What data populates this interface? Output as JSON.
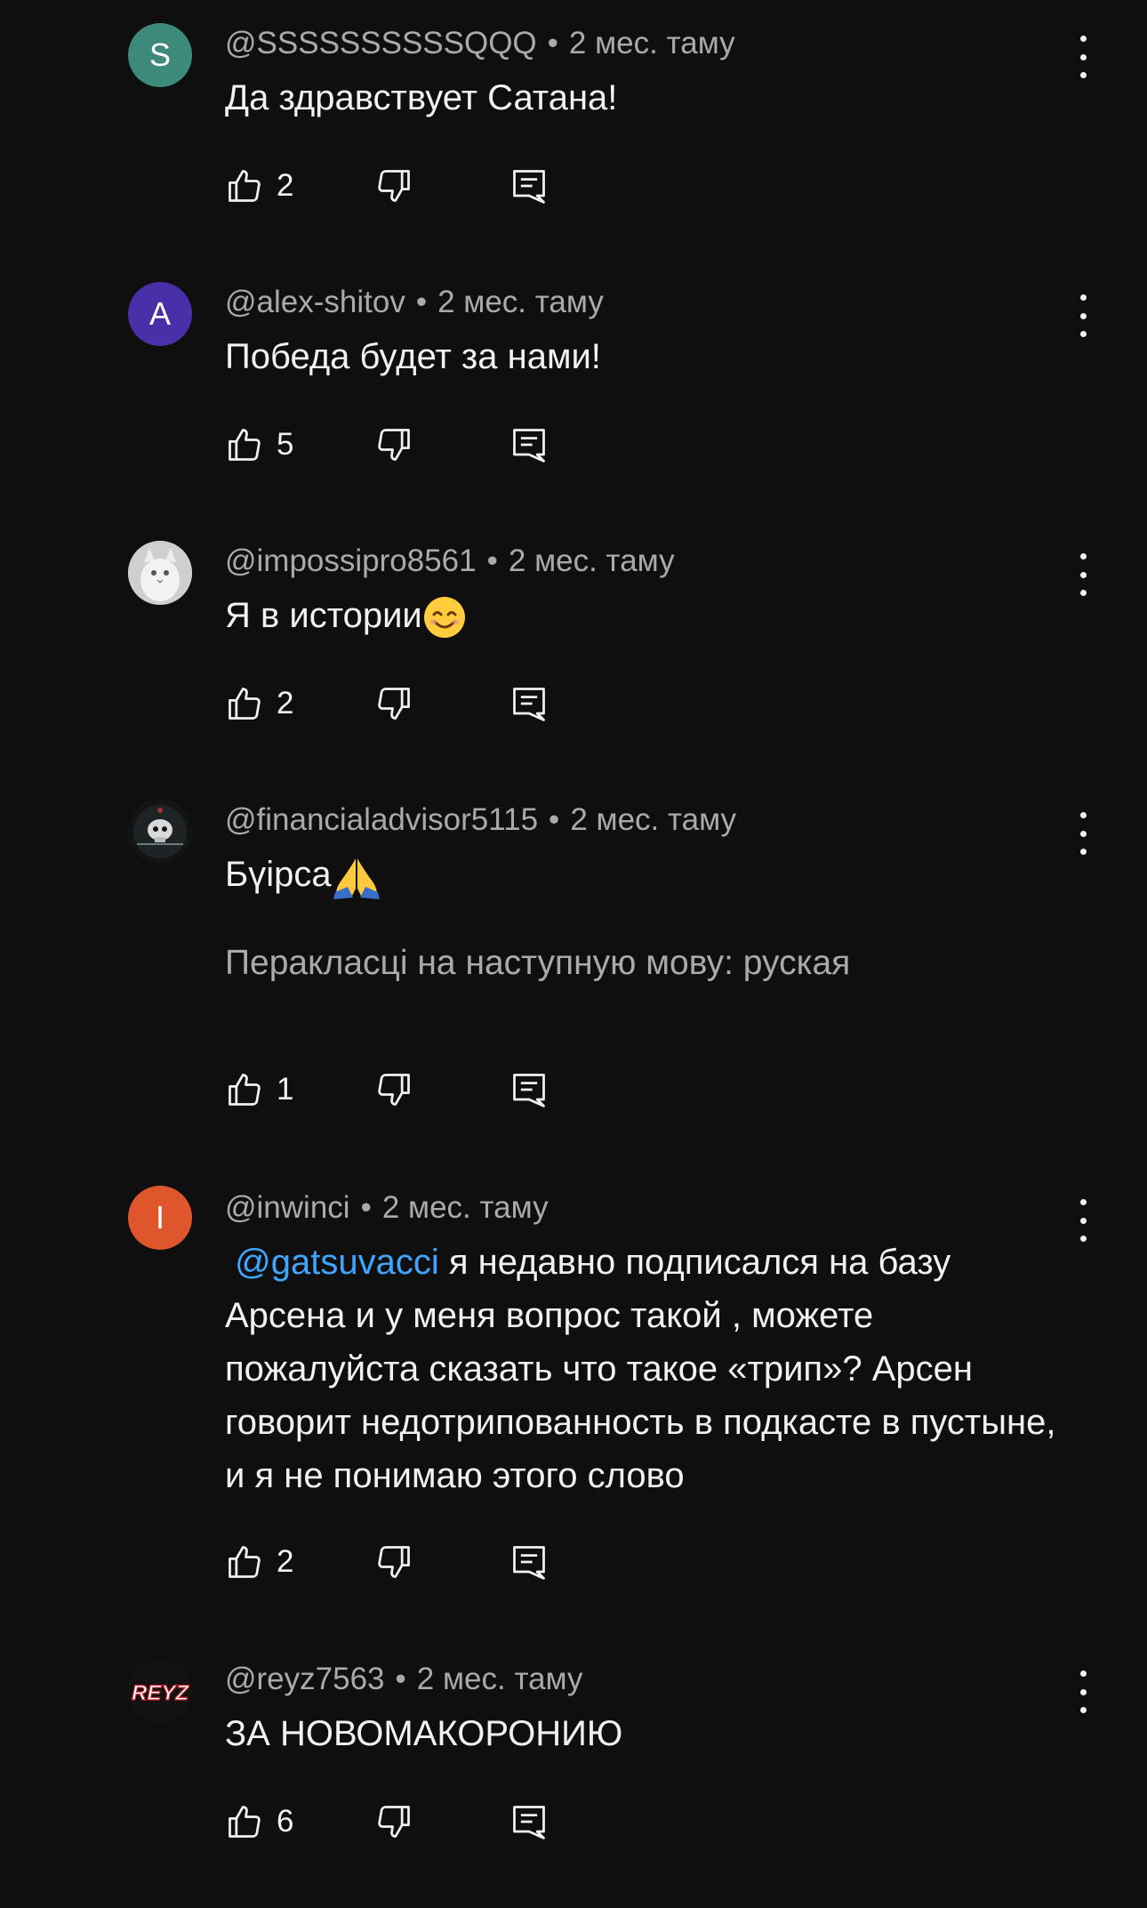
{
  "colors": {
    "background": "#0f0f0f",
    "text_primary": "#f1f1f1",
    "text_secondary": "#aaaaaa",
    "mention": "#3ea6ff"
  },
  "comments": [
    {
      "avatar_letter": "S",
      "avatar_color": "#3d8a7a",
      "author": "@SSSSSSSSSSQQQ",
      "time": "2 мес. таму",
      "text": "Да здравствует Сатана!",
      "likes": "2"
    },
    {
      "avatar_letter": "A",
      "avatar_color": "#4a30a8",
      "author": "@alex-shitov",
      "time": "2 мес. таму",
      "text": "Победа будет за нами!",
      "likes": "5"
    },
    {
      "avatar_icon": "cat-photo-avatar",
      "author": "@impossipro8561",
      "time": "2 мес. таму",
      "text": "Я в истории",
      "emoji": "smiling-face-emoji",
      "likes": "2"
    },
    {
      "avatar_icon": "dark-skull-avatar",
      "author": "@financialadvisor5115",
      "time": "2 мес. таму",
      "text": "Бүірса",
      "emoji": "praying-hands-emoji",
      "translate": "Перакласці на наступную мову: руская",
      "likes": "1"
    },
    {
      "avatar_letter": "I",
      "avatar_color": "#e0562c",
      "author": "@inwinci",
      "time": "2 мес. таму",
      "mention": "@gatsuvacci",
      "text": " я недавно подписался на базу Арсена и у меня вопрос такой , можете пожалуйста сказать что такое «трип»? Арсен говорит недотрипованность в подкасте в пустыне, и я не понимаю этого слово",
      "likes": "2"
    },
    {
      "avatar_logo_text": "REYZ",
      "author": "@reyz7563",
      "time": "2 мес. таму",
      "text": "ЗА НОВОМАКОРОНИЮ",
      "likes": "6"
    }
  ]
}
